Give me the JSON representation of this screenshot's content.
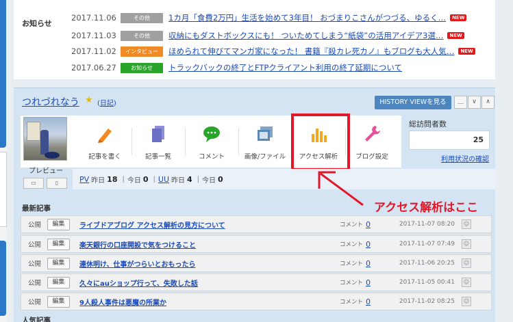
{
  "news": {
    "title": "お知らせ",
    "items": [
      {
        "date": "2017.11.06",
        "badge": "その他",
        "badge_color": "#a0a0a0",
        "text": "1カ月「食費2万円」生活を始めて3年目！ おづまりこさんがつづる、ゆるく…",
        "new": "NEW"
      },
      {
        "date": "2017.11.03",
        "badge": "その他",
        "badge_color": "#a0a0a0",
        "text": "収納にもダストボックスにも！ ついためてしまう“紙袋”の活用アイデア3選…",
        "new": "NEW"
      },
      {
        "date": "2017.11.02",
        "badge": "インタビュー",
        "badge_color": "#f08a24",
        "text": "ほめられて伸びてマンガ家になった！ 書籍『殺カレ死カノ』もブログも大人気…",
        "new": "NEW"
      },
      {
        "date": "2017.06.27",
        "badge": "お知らせ",
        "badge_color": "#2aa52a",
        "text": "トラックバックの終了とFTPクライアント利用の終了延期について",
        "new": ""
      }
    ]
  },
  "blog": {
    "title": "つれづれなう",
    "diary_open": "(",
    "diary": "日記",
    "diary_close": ")",
    "history_button": "HISTORY VIEWを見る",
    "controls": [
      "＿",
      "∨",
      "∧"
    ]
  },
  "tools": [
    {
      "label": "記事を書く",
      "icon": "pencil-icon"
    },
    {
      "label": "記事一覧",
      "icon": "document-icon"
    },
    {
      "label": "コメント",
      "icon": "comment-icon"
    },
    {
      "label": "画像/ファイル",
      "icon": "image-icon"
    },
    {
      "label": "アクセス解析",
      "icon": "bar-chart-icon"
    },
    {
      "label": "ブログ設定",
      "icon": "wrench-icon"
    }
  ],
  "visits": {
    "label": "総訪問者数",
    "count": "25",
    "link": "利用状況の確認"
  },
  "preview": {
    "label": "プレビュー",
    "pc": "▭",
    "mobile": "▯"
  },
  "stats": {
    "pv": "PV",
    "uu": "UU",
    "yesterday": "昨日",
    "today": "今日",
    "pv_yesterday": "18",
    "pv_today": "0",
    "uu_yesterday": "4",
    "uu_today": "0",
    "sep": "|"
  },
  "recent": {
    "title": "最新記事",
    "status": "公開",
    "edit": "編集",
    "comment_label": "コメント",
    "posts": [
      {
        "title": "ライブドアブログ アクセス解析の見方について",
        "comments": "0",
        "date": "2017-11-07 08:20"
      },
      {
        "title": "楽天銀行の口座開設で気をつけること",
        "comments": "0",
        "date": "2017-11-07 07:49"
      },
      {
        "title": "連休明け、仕事がつらいとおもったら",
        "comments": "0",
        "date": "2017-11-06 20:25"
      },
      {
        "title": "久々にauショップ行って、失敗した話",
        "comments": "0",
        "date": "2017-11-05 00:41"
      },
      {
        "title": "9人殺人事件は悪魔の所業か",
        "comments": "0",
        "date": "2017-11-02 08:25"
      }
    ]
  },
  "popular": {
    "title": "人気記事"
  },
  "annotation": {
    "text": "アクセス解析はここ",
    "color": "#e0182a"
  }
}
